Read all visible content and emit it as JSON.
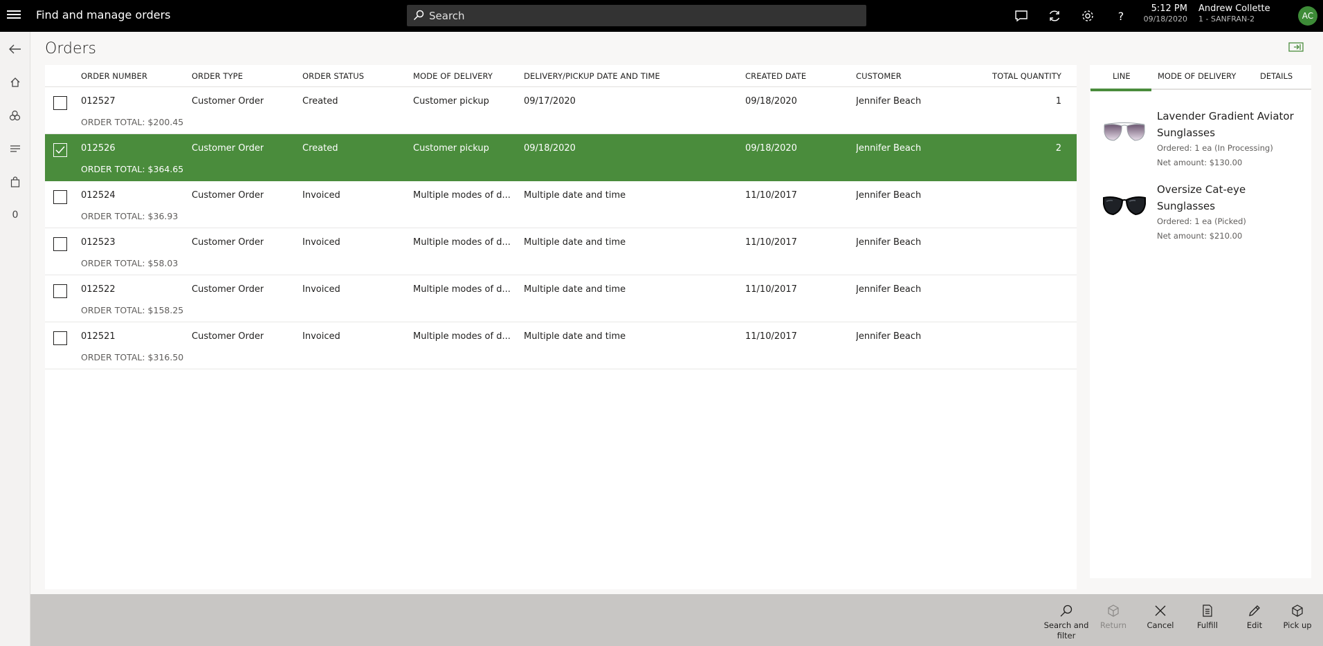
{
  "header": {
    "app_title": "Find and manage orders",
    "search_placeholder": "Search",
    "time": "5:12 PM",
    "date": "09/18/2020",
    "user_name": "Andrew Collette",
    "store": "1 - SANFRAN-2",
    "avatar_initials": "AC"
  },
  "leftnav": {
    "cart_count": "0"
  },
  "page": {
    "title": "Orders"
  },
  "grid": {
    "columns": {
      "order_number": "ORDER NUMBER",
      "order_type": "ORDER TYPE",
      "order_status": "ORDER STATUS",
      "mode_of_delivery": "MODE OF DELIVERY",
      "delivery_date": "DELIVERY/PICKUP DATE AND TIME",
      "created_date": "CREATED DATE",
      "customer": "CUSTOMER",
      "total_quantity": "TOTAL QUANTITY"
    },
    "rows": [
      {
        "order_number": "012527",
        "order_type": "Customer Order",
        "status": "Created",
        "mode": "Customer pickup",
        "delivery": "09/17/2020",
        "created": "09/18/2020",
        "customer": "Jennifer Beach",
        "qty": "1",
        "total": "ORDER TOTAL: $200.45",
        "selected": false
      },
      {
        "order_number": "012526",
        "order_type": "Customer Order",
        "status": "Created",
        "mode": "Customer pickup",
        "delivery": "09/18/2020",
        "created": "09/18/2020",
        "customer": "Jennifer Beach",
        "qty": "2",
        "total": "ORDER TOTAL: $364.65",
        "selected": true
      },
      {
        "order_number": "012524",
        "order_type": "Customer Order",
        "status": "Invoiced",
        "mode": "Multiple modes of d...",
        "delivery": "Multiple date and time",
        "created": "11/10/2017",
        "customer": "Jennifer Beach",
        "qty": "",
        "total": "ORDER TOTAL: $36.93",
        "selected": false
      },
      {
        "order_number": "012523",
        "order_type": "Customer Order",
        "status": "Invoiced",
        "mode": "Multiple modes of d...",
        "delivery": "Multiple date and time",
        "created": "11/10/2017",
        "customer": "Jennifer Beach",
        "qty": "",
        "total": "ORDER TOTAL: $58.03",
        "selected": false
      },
      {
        "order_number": "012522",
        "order_type": "Customer Order",
        "status": "Invoiced",
        "mode": "Multiple modes of d...",
        "delivery": "Multiple date and time",
        "created": "11/10/2017",
        "customer": "Jennifer Beach",
        "qty": "",
        "total": "ORDER TOTAL: $158.25",
        "selected": false
      },
      {
        "order_number": "012521",
        "order_type": "Customer Order",
        "status": "Invoiced",
        "mode": "Multiple modes of d...",
        "delivery": "Multiple date and time",
        "created": "11/10/2017",
        "customer": "Jennifer Beach",
        "qty": "",
        "total": "ORDER TOTAL: $316.50",
        "selected": false
      }
    ]
  },
  "panel": {
    "tabs": [
      "LINE",
      "MODE OF DELIVERY",
      "DETAILS"
    ],
    "active_tab": "LINE",
    "lines": [
      {
        "name": "Lavender Gradient Aviator Sunglasses",
        "ordered": "Ordered: 1 ea (In Processing)",
        "net": "Net amount: $130.00",
        "image": "aviator-sunglasses-image"
      },
      {
        "name": "Oversize Cat-eye Sunglasses",
        "ordered": "Ordered: 1 ea (Picked)",
        "net": "Net amount: $210.00",
        "image": "cat-eye-sunglasses-image"
      }
    ]
  },
  "actions": {
    "search_filter": "Search and filter",
    "return": "Return",
    "cancel": "Cancel",
    "fulfill": "Fulfill",
    "edit": "Edit",
    "pickup": "Pick up"
  },
  "colors": {
    "accent": "#4a8c3c",
    "topbar": "#000000",
    "actionbar": "#c8c6c4"
  }
}
